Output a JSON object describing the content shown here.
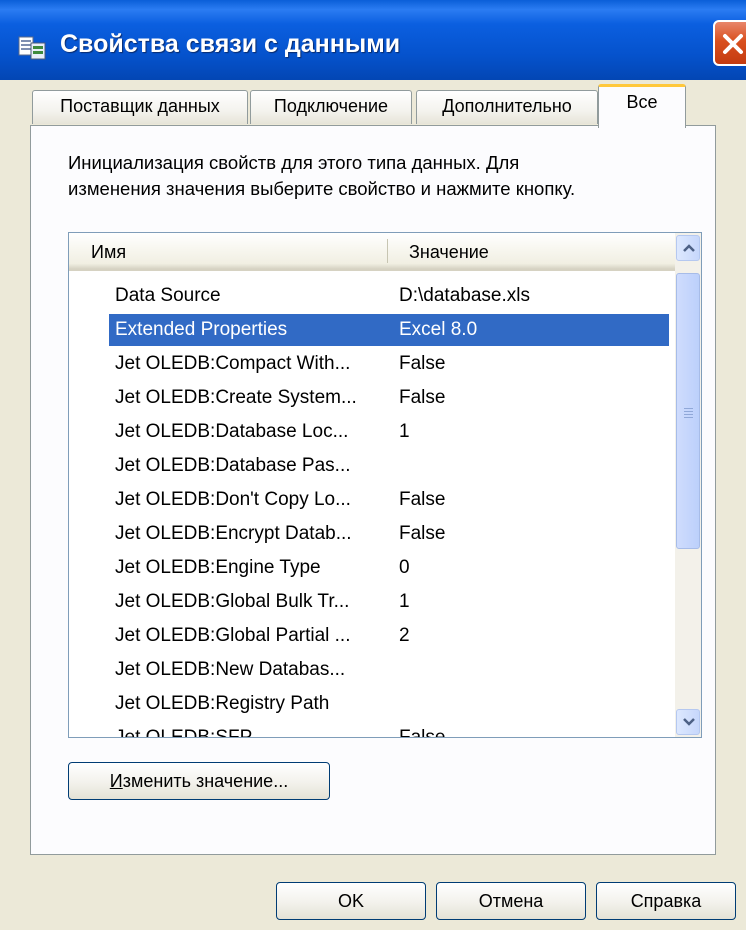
{
  "window": {
    "title": "Свойства связи с данными",
    "title_icon": "data-link-icon",
    "close_icon": "close-icon"
  },
  "tabs": [
    {
      "label": "Поставщик данных",
      "active": false
    },
    {
      "label": "Подключение",
      "active": false
    },
    {
      "label": "Дополнительно",
      "active": false
    },
    {
      "label": "Все",
      "active": true
    }
  ],
  "description": {
    "line1": "Инициализация свойств для этого типа данных. Для",
    "line2": "изменения значения выберите свойство и нажмите кнопку."
  },
  "properties": {
    "columns": {
      "name": "Имя",
      "value": "Значение"
    },
    "rows": [
      {
        "name": "Data Source",
        "value": "D:\\database.xls"
      },
      {
        "name": "Extended Properties",
        "value": "Excel 8.0",
        "selected": true
      },
      {
        "name": "Jet OLEDB:Compact With...",
        "value": "False"
      },
      {
        "name": "Jet OLEDB:Create System...",
        "value": "False"
      },
      {
        "name": "Jet OLEDB:Database Loc...",
        "value": "1"
      },
      {
        "name": "Jet OLEDB:Database Pas...",
        "value": ""
      },
      {
        "name": "Jet OLEDB:Don't Copy Lo...",
        "value": "False"
      },
      {
        "name": "Jet OLEDB:Encrypt Datab...",
        "value": "False"
      },
      {
        "name": "Jet OLEDB:Engine Type",
        "value": "0"
      },
      {
        "name": "Jet OLEDB:Global Bulk Tr...",
        "value": "1"
      },
      {
        "name": "Jet OLEDB:Global Partial ...",
        "value": "2"
      },
      {
        "name": "Jet OLEDB:New Databas...",
        "value": ""
      },
      {
        "name": "Jet OLEDB:Registry Path",
        "value": ""
      },
      {
        "name": "Jet OLEDB:SFP",
        "value": "False"
      }
    ]
  },
  "edit_button": {
    "label_underlined": "И",
    "label_rest": "зменить значение..."
  },
  "footer": {
    "ok": "OK",
    "cancel": "Отмена",
    "help": "Справка"
  },
  "colors": {
    "selection": "#316ac5",
    "titlebar": "#0552cc",
    "active_tab_accent": "#ffc83c"
  }
}
